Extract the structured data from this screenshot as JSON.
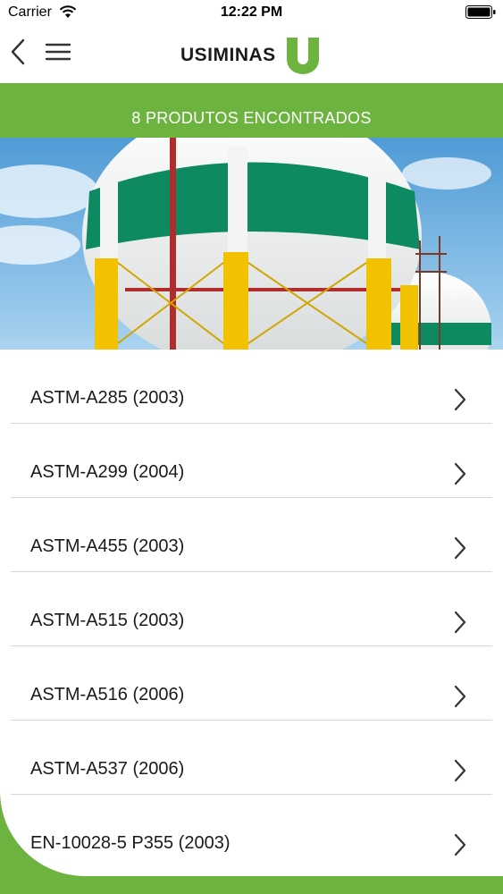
{
  "status_bar": {
    "carrier": "Carrier",
    "time": "12:22 PM"
  },
  "nav": {
    "logo_text": "USIMINAS",
    "back_icon": "chevron-left-icon",
    "menu_icon": "hamburger-icon"
  },
  "banner": {
    "title": "8 PRODUTOS ENCONTRADOS"
  },
  "colors": {
    "brand_green": "#6db33f",
    "tank_green": "#0e8a63",
    "support_yellow": "#f2c200"
  },
  "products": [
    {
      "label": "ASTM-A285 (2003)"
    },
    {
      "label": "ASTM-A299 (2004)"
    },
    {
      "label": "ASTM-A455 (2003)"
    },
    {
      "label": "ASTM-A515 (2003)"
    },
    {
      "label": "ASTM-A516 (2006)"
    },
    {
      "label": "ASTM-A537 (2006)"
    },
    {
      "label": "EN-10028-5 P355 (2003)"
    }
  ]
}
